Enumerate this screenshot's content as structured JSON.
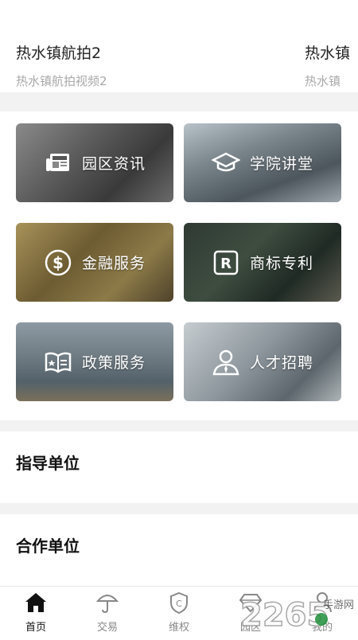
{
  "carousel": {
    "cards": [
      {
        "title": "热水镇航拍2",
        "subtitle": "热水镇航拍视频2"
      },
      {
        "title": "热水镇",
        "subtitle": "热水镇"
      }
    ]
  },
  "tiles": [
    {
      "label": "园区资讯",
      "icon": "newspaper-icon"
    },
    {
      "label": "学院讲堂",
      "icon": "graduation-cap-icon"
    },
    {
      "label": "金融服务",
      "icon": "dollar-coin-icon"
    },
    {
      "label": "商标专利",
      "icon": "registered-trademark-icon"
    },
    {
      "label": "政策服务",
      "icon": "policy-book-icon"
    },
    {
      "label": "人才招聘",
      "icon": "person-icon"
    }
  ],
  "sections": {
    "guidance_title": "指导单位",
    "partner_title": "合作单位"
  },
  "tabbar": {
    "items": [
      {
        "label": "首页",
        "icon": "home-icon",
        "active": true
      },
      {
        "label": "交易",
        "icon": "umbrella-icon",
        "active": false
      },
      {
        "label": "维权",
        "icon": "shield-c-icon",
        "active": false
      },
      {
        "label": "园区",
        "icon": "diamond-icon",
        "active": false
      },
      {
        "label": "我的",
        "icon": "user-icon",
        "active": false
      }
    ]
  },
  "watermark": {
    "text": "2265",
    "sub": "手游网",
    "accent": "#1f8f3a"
  }
}
